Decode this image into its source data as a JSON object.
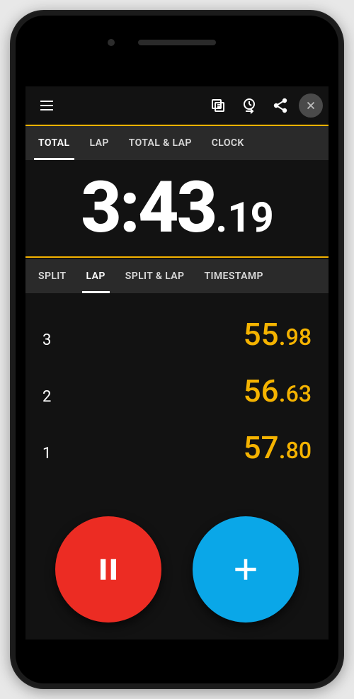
{
  "colors": {
    "accent": "#f5b300",
    "pause_button": "#ec2c23",
    "lap_button": "#0aa7e8"
  },
  "display_tabs": {
    "items": [
      "TOTAL",
      "LAP",
      "TOTAL & LAP",
      "CLOCK"
    ],
    "active_index": 0
  },
  "main_time": {
    "major": "3:43",
    "fraction": "19"
  },
  "list_tabs": {
    "items": [
      "SPLIT",
      "LAP",
      "SPLIT & LAP",
      "TIMESTAMP"
    ],
    "active_index": 1
  },
  "laps": [
    {
      "index": "3",
      "seconds": "55",
      "fraction": "98"
    },
    {
      "index": "2",
      "seconds": "56",
      "fraction": "63"
    },
    {
      "index": "1",
      "seconds": "57",
      "fraction": "80"
    }
  ]
}
